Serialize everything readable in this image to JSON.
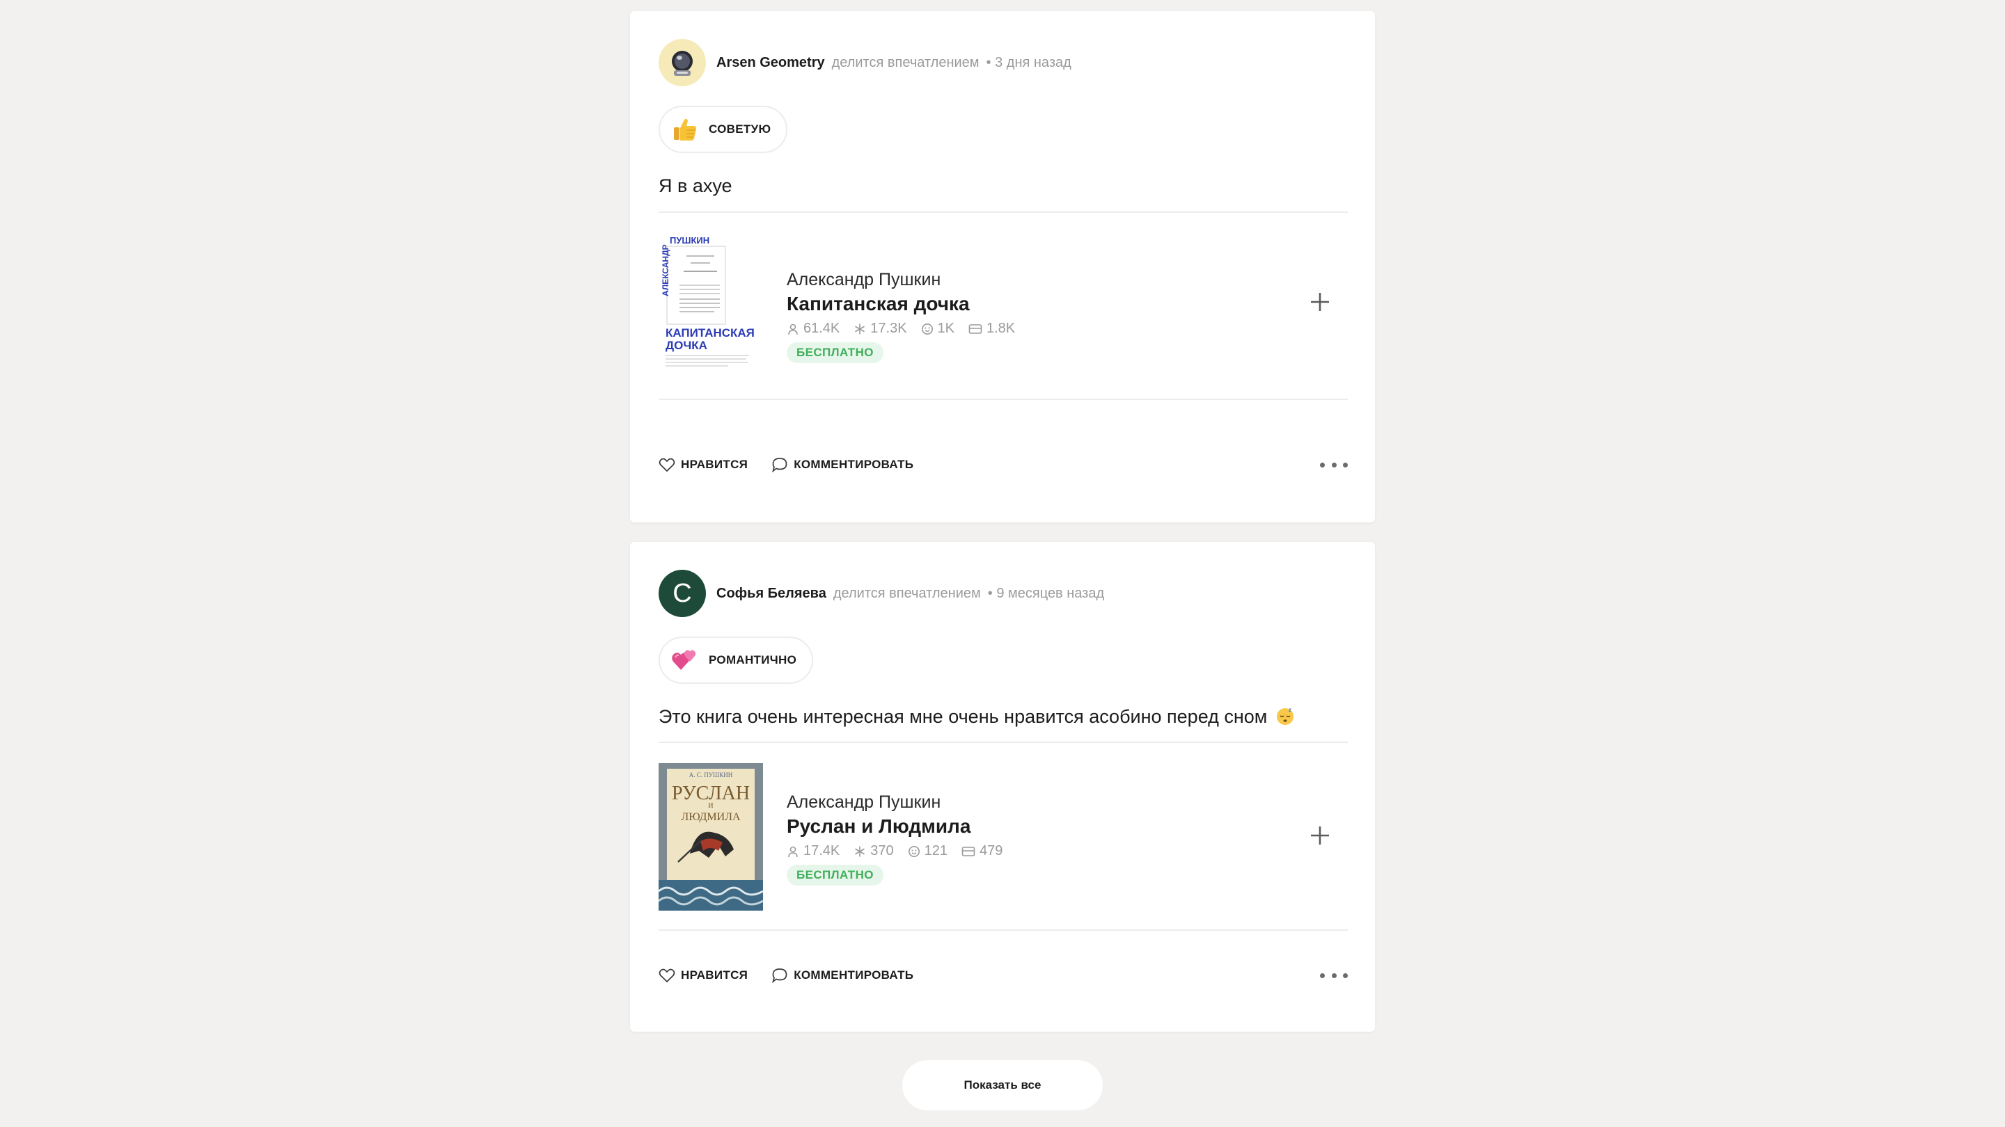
{
  "posts": [
    {
      "user_name": "Arsen Geometry",
      "action": "делится впечатлением",
      "time": "• 3 дня назад",
      "tag": {
        "emoji": "thumbs-up-icon",
        "label": "СОВЕТУЮ"
      },
      "review": "Я в ахуе",
      "book": {
        "cover_lines": [
          "ПУШКИН",
          "АЛЕКСАНДР",
          "КАПИТАНСКАЯ",
          "ДОЧКА"
        ],
        "author": "Александр Пушкин",
        "title": "Капитанская дочка",
        "stats": {
          "readers": "61.4K",
          "rating": "17.3K",
          "impressions": "1K",
          "quotes": "1.8K"
        },
        "badge": "БЕСПЛАТНО"
      },
      "like_label": "НРАВИТСЯ",
      "comment_label": "КОММЕНТИРОВАТЬ"
    },
    {
      "user_name": "Софья Беляева",
      "avatar_letter": "С",
      "action": "делится впечатлением",
      "time": "• 9 месяцев назад",
      "tag": {
        "emoji": "hearts-icon",
        "label": "РОМАНТИЧНО"
      },
      "review": "Это книга очень интересная мне очень нравится асобино перед сном",
      "review_emoji": "sleeping-face-icon",
      "book": {
        "cover_lines": [
          "А. С. ПУШКИН",
          "РУСЛАН",
          "И",
          "ЛЮДМИЛА"
        ],
        "author": "Александр Пушкин",
        "title": "Руслан и Людмила",
        "stats": {
          "readers": "17.4K",
          "rating": "370",
          "impressions": "121",
          "quotes": "479"
        },
        "badge": "БЕСПЛАТНО"
      },
      "like_label": "НРАВИТСЯ",
      "comment_label": "КОММЕНТИРОВАТЬ"
    }
  ],
  "show_all_label": "Показать все",
  "colors": {
    "background": "#f2f1ef",
    "badge_text": "#3faf5b",
    "badge_bg": "#e7f6ea",
    "avatar_green": "#1e4a3a",
    "cover_blue": "#2b3bb5"
  }
}
